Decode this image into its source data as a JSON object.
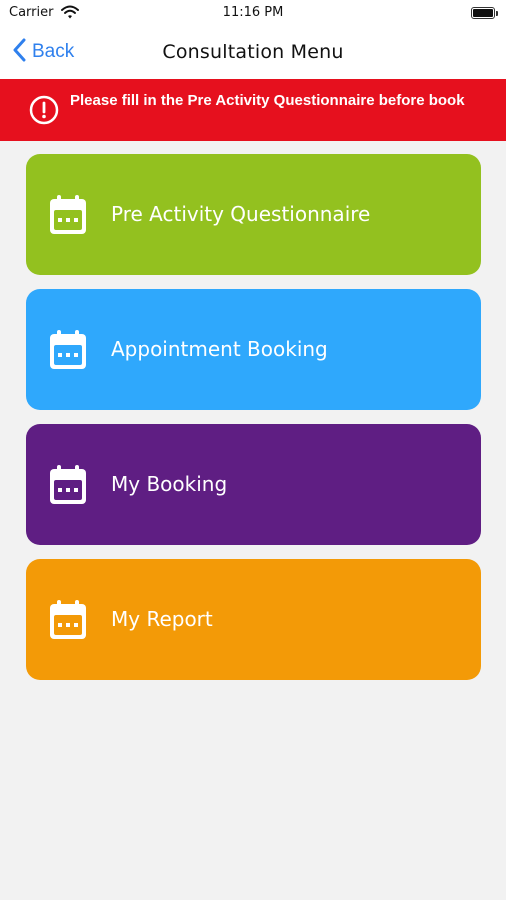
{
  "status_bar": {
    "carrier": "Carrier",
    "time": "11:16 PM"
  },
  "nav": {
    "back_label": "Back",
    "title": "Consultation Menu"
  },
  "alert": {
    "message": "Please fill in the Pre Activity Questionnaire before book"
  },
  "menu": {
    "items": [
      {
        "label": "Pre Activity Questionnaire",
        "icon": "calendar-icon",
        "color": "#93c11f"
      },
      {
        "label": "Appointment Booking",
        "icon": "calendar-icon",
        "color": "#2fa8fc"
      },
      {
        "label": "My Booking",
        "icon": "calendar-icon",
        "color": "#5f1e83"
      },
      {
        "label": "My Report",
        "icon": "calendar-icon",
        "color": "#f39a07"
      }
    ]
  }
}
